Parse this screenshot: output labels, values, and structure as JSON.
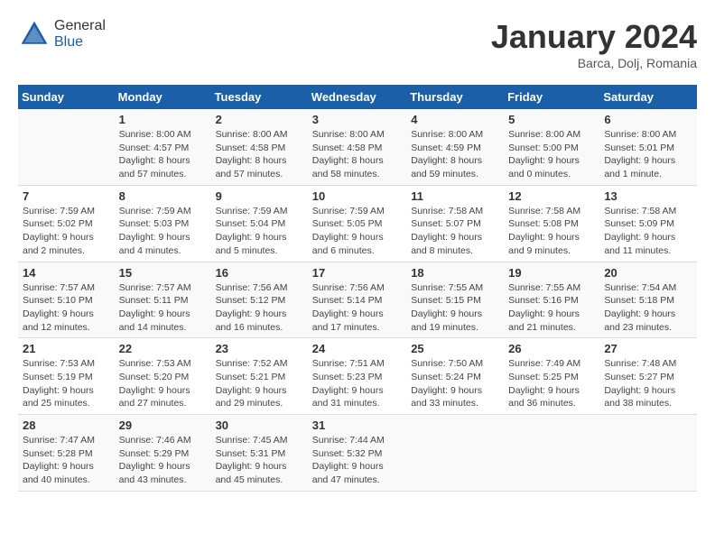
{
  "header": {
    "logo_general": "General",
    "logo_blue": "Blue",
    "month_title": "January 2024",
    "location": "Barca, Dolj, Romania"
  },
  "days_of_week": [
    "Sunday",
    "Monday",
    "Tuesday",
    "Wednesday",
    "Thursday",
    "Friday",
    "Saturday"
  ],
  "weeks": [
    [
      {
        "day": "",
        "info": ""
      },
      {
        "day": "1",
        "info": "Sunrise: 8:00 AM\nSunset: 4:57 PM\nDaylight: 8 hours\nand 57 minutes."
      },
      {
        "day": "2",
        "info": "Sunrise: 8:00 AM\nSunset: 4:58 PM\nDaylight: 8 hours\nand 57 minutes."
      },
      {
        "day": "3",
        "info": "Sunrise: 8:00 AM\nSunset: 4:58 PM\nDaylight: 8 hours\nand 58 minutes."
      },
      {
        "day": "4",
        "info": "Sunrise: 8:00 AM\nSunset: 4:59 PM\nDaylight: 8 hours\nand 59 minutes."
      },
      {
        "day": "5",
        "info": "Sunrise: 8:00 AM\nSunset: 5:00 PM\nDaylight: 9 hours\nand 0 minutes."
      },
      {
        "day": "6",
        "info": "Sunrise: 8:00 AM\nSunset: 5:01 PM\nDaylight: 9 hours\nand 1 minute."
      }
    ],
    [
      {
        "day": "7",
        "info": "Sunrise: 7:59 AM\nSunset: 5:02 PM\nDaylight: 9 hours\nand 2 minutes."
      },
      {
        "day": "8",
        "info": "Sunrise: 7:59 AM\nSunset: 5:03 PM\nDaylight: 9 hours\nand 4 minutes."
      },
      {
        "day": "9",
        "info": "Sunrise: 7:59 AM\nSunset: 5:04 PM\nDaylight: 9 hours\nand 5 minutes."
      },
      {
        "day": "10",
        "info": "Sunrise: 7:59 AM\nSunset: 5:05 PM\nDaylight: 9 hours\nand 6 minutes."
      },
      {
        "day": "11",
        "info": "Sunrise: 7:58 AM\nSunset: 5:07 PM\nDaylight: 9 hours\nand 8 minutes."
      },
      {
        "day": "12",
        "info": "Sunrise: 7:58 AM\nSunset: 5:08 PM\nDaylight: 9 hours\nand 9 minutes."
      },
      {
        "day": "13",
        "info": "Sunrise: 7:58 AM\nSunset: 5:09 PM\nDaylight: 9 hours\nand 11 minutes."
      }
    ],
    [
      {
        "day": "14",
        "info": "Sunrise: 7:57 AM\nSunset: 5:10 PM\nDaylight: 9 hours\nand 12 minutes."
      },
      {
        "day": "15",
        "info": "Sunrise: 7:57 AM\nSunset: 5:11 PM\nDaylight: 9 hours\nand 14 minutes."
      },
      {
        "day": "16",
        "info": "Sunrise: 7:56 AM\nSunset: 5:12 PM\nDaylight: 9 hours\nand 16 minutes."
      },
      {
        "day": "17",
        "info": "Sunrise: 7:56 AM\nSunset: 5:14 PM\nDaylight: 9 hours\nand 17 minutes."
      },
      {
        "day": "18",
        "info": "Sunrise: 7:55 AM\nSunset: 5:15 PM\nDaylight: 9 hours\nand 19 minutes."
      },
      {
        "day": "19",
        "info": "Sunrise: 7:55 AM\nSunset: 5:16 PM\nDaylight: 9 hours\nand 21 minutes."
      },
      {
        "day": "20",
        "info": "Sunrise: 7:54 AM\nSunset: 5:18 PM\nDaylight: 9 hours\nand 23 minutes."
      }
    ],
    [
      {
        "day": "21",
        "info": "Sunrise: 7:53 AM\nSunset: 5:19 PM\nDaylight: 9 hours\nand 25 minutes."
      },
      {
        "day": "22",
        "info": "Sunrise: 7:53 AM\nSunset: 5:20 PM\nDaylight: 9 hours\nand 27 minutes."
      },
      {
        "day": "23",
        "info": "Sunrise: 7:52 AM\nSunset: 5:21 PM\nDaylight: 9 hours\nand 29 minutes."
      },
      {
        "day": "24",
        "info": "Sunrise: 7:51 AM\nSunset: 5:23 PM\nDaylight: 9 hours\nand 31 minutes."
      },
      {
        "day": "25",
        "info": "Sunrise: 7:50 AM\nSunset: 5:24 PM\nDaylight: 9 hours\nand 33 minutes."
      },
      {
        "day": "26",
        "info": "Sunrise: 7:49 AM\nSunset: 5:25 PM\nDaylight: 9 hours\nand 36 minutes."
      },
      {
        "day": "27",
        "info": "Sunrise: 7:48 AM\nSunset: 5:27 PM\nDaylight: 9 hours\nand 38 minutes."
      }
    ],
    [
      {
        "day": "28",
        "info": "Sunrise: 7:47 AM\nSunset: 5:28 PM\nDaylight: 9 hours\nand 40 minutes."
      },
      {
        "day": "29",
        "info": "Sunrise: 7:46 AM\nSunset: 5:29 PM\nDaylight: 9 hours\nand 43 minutes."
      },
      {
        "day": "30",
        "info": "Sunrise: 7:45 AM\nSunset: 5:31 PM\nDaylight: 9 hours\nand 45 minutes."
      },
      {
        "day": "31",
        "info": "Sunrise: 7:44 AM\nSunset: 5:32 PM\nDaylight: 9 hours\nand 47 minutes."
      },
      {
        "day": "",
        "info": ""
      },
      {
        "day": "",
        "info": ""
      },
      {
        "day": "",
        "info": ""
      }
    ]
  ]
}
